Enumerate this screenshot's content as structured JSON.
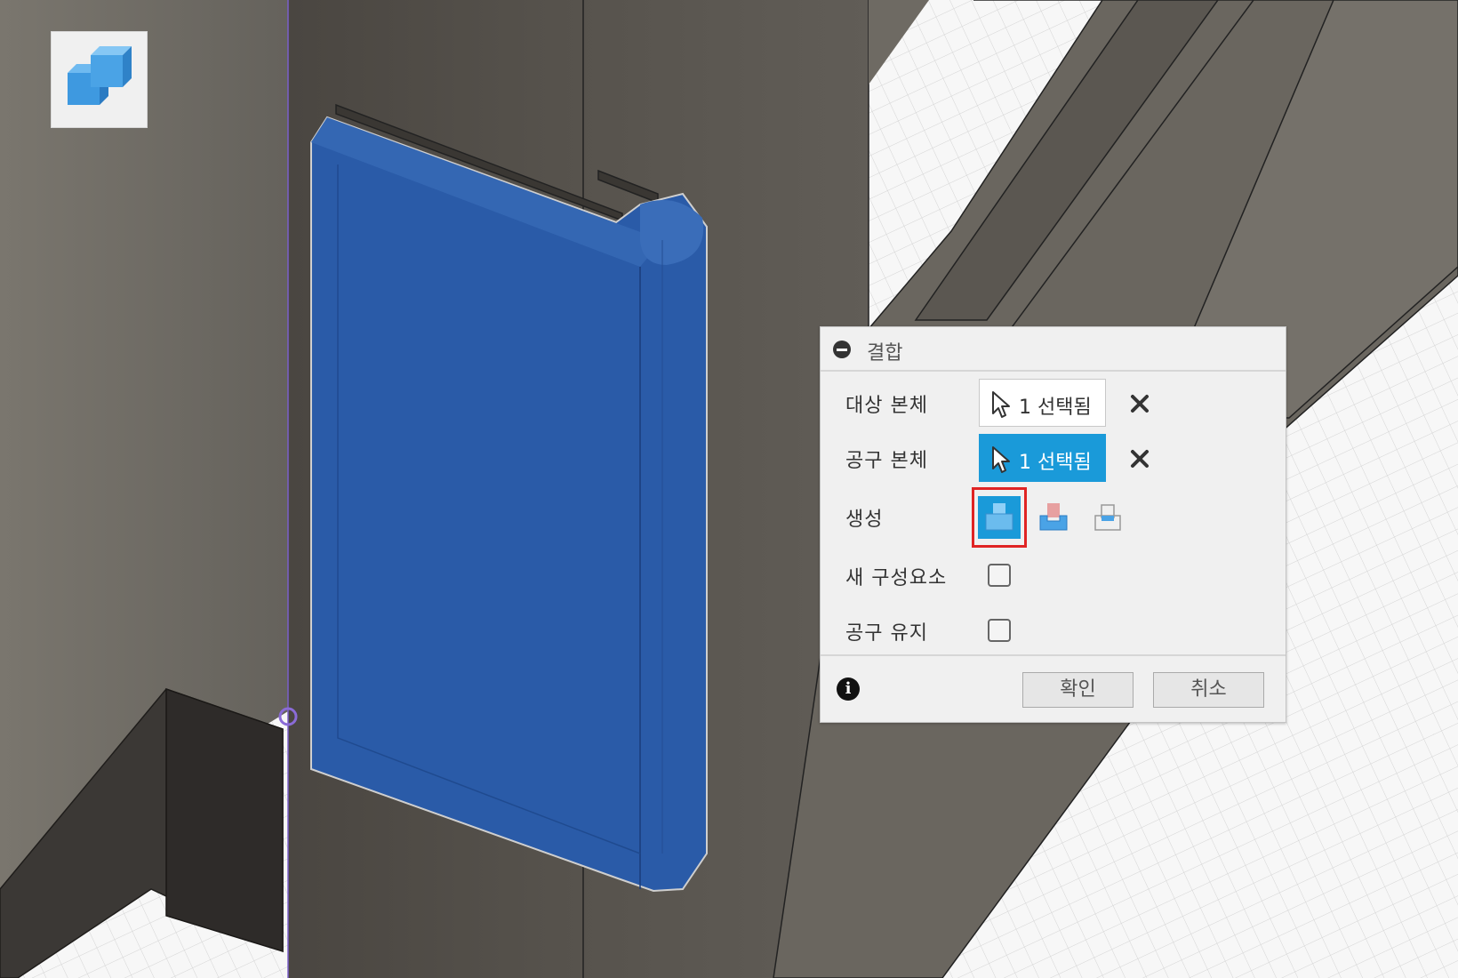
{
  "app": {
    "tool_icon": "combine-tool-icon"
  },
  "colors": {
    "accent": "#1a9ad9",
    "highlight_border": "#e02424",
    "selected_body": "#2a5ba8"
  },
  "combine_dialog": {
    "title": "결합",
    "target_body": {
      "label": "대상 본체",
      "value": "1 선택됨"
    },
    "tool_bodies": {
      "label": "공구 본체",
      "value": "1 선택됨"
    },
    "operation": {
      "label": "생성",
      "options": [
        "join-icon",
        "cut-icon",
        "intersect-icon"
      ],
      "selected": "join-icon"
    },
    "new_component": {
      "label": "새 구성요소",
      "checked": false
    },
    "keep_tools": {
      "label": "공구 유지",
      "checked": false
    },
    "ok_label": "확인",
    "cancel_label": "취소"
  }
}
